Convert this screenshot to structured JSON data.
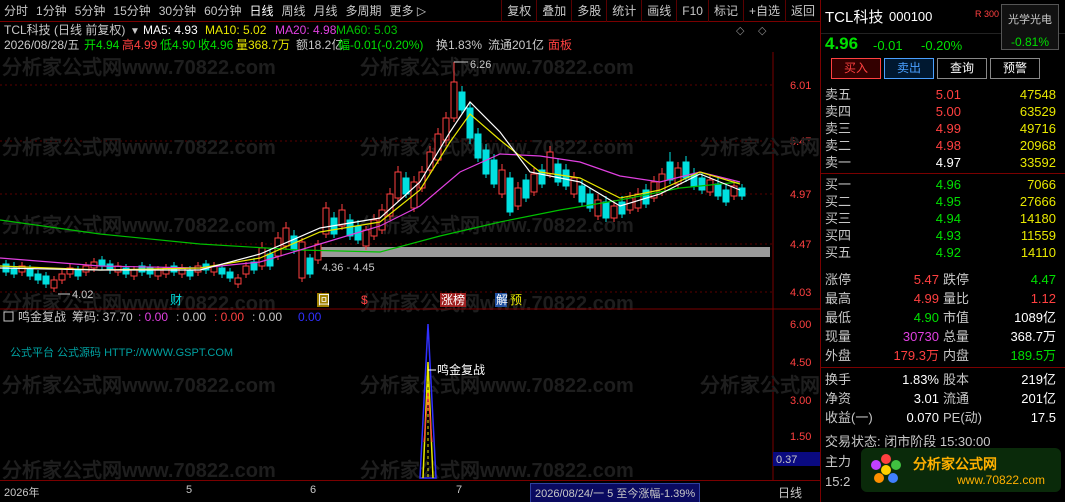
{
  "toolbar": {
    "periods": [
      "分时",
      "1分钟",
      "5分钟",
      "15分钟",
      "30分钟",
      "60分钟",
      "日线",
      "周线",
      "月线",
      "多周期",
      "更多 ▷"
    ],
    "active_period": "日线",
    "tools": [
      "复权",
      "叠加",
      "多股",
      "统计",
      "画线",
      "F10",
      "标记",
      "+自选",
      "返回"
    ]
  },
  "chart": {
    "header_name": "TCL科技 (日线 前复权)",
    "ma5": "MA5: 4.93",
    "ma10": "MA10: 5.02",
    "ma20": "MA20: 4.98",
    "ma60": "MA60: 5.03",
    "bar_date": "2026/08/28/五",
    "bar_open": "开4.94",
    "bar_high": "高4.99",
    "bar_low": "低4.90",
    "bar_close": "收4.96",
    "bar_volume": "量368.7万",
    "bar_amount": "额18.2亿",
    "bar_change": "幅-0.01(-0.20%)",
    "bar_turnover": "换1.83%",
    "bar_float": "流通201亿",
    "bar_board": "面板",
    "price_ticks": [
      "6.01",
      "5.47",
      "4.97",
      "4.47",
      "4.03"
    ],
    "high_label": "6.26",
    "low_label": "4.02",
    "range_label": "4.36 - 4.45",
    "event_tags": [
      "财",
      "回",
      "$",
      "涨榜",
      "解",
      "预"
    ],
    "watermark": "分析家公式网www.70822.com",
    "colors": {
      "up": "#ff4040",
      "down": "#00e0e0",
      "ma5": "#ffffff",
      "ma10": "#e8e800",
      "ma20": "#e040e0",
      "ma60": "#00c000"
    }
  },
  "indicator": {
    "name": "鸣金复战",
    "label": "筹码: 37.70",
    "values": [
      ": 0.00",
      ": 0.00",
      ": 0.00",
      ": 0.00",
      "0.00"
    ],
    "subtitle": "公式平台 公式源码 HTTP://WWW.GSPT.COM",
    "signal_label": "鸣金复战",
    "ticks": [
      "6.00",
      "4.50",
      "3.00",
      "1.50"
    ],
    "current": "0.37"
  },
  "bottom": {
    "x_labels": [
      "2026年",
      "5",
      "6",
      "7"
    ],
    "hint": "2026/08/24/一 5 至今涨幅-1.39%",
    "mode": "日线"
  },
  "quote": {
    "name": "TCL科技",
    "code": "000100",
    "r_tag": "R 300",
    "sector_name": "光学光电",
    "sector_pct": "-0.81%",
    "price": "4.96",
    "change": "-0.01",
    "pct": "-0.20%",
    "buttons": [
      "买入",
      "卖出",
      "查询",
      "预警"
    ],
    "asks": [
      {
        "label": "卖五",
        "price": "5.01",
        "vol": "47548",
        "color": "red"
      },
      {
        "label": "卖四",
        "price": "5.00",
        "vol": "63529",
        "color": "red"
      },
      {
        "label": "卖三",
        "price": "4.99",
        "vol": "49716",
        "color": "red"
      },
      {
        "label": "卖二",
        "price": "4.98",
        "vol": "20968",
        "color": "red"
      },
      {
        "label": "卖一",
        "price": "4.97",
        "vol": "33592",
        "color": "white"
      }
    ],
    "bids": [
      {
        "label": "买一",
        "price": "4.96",
        "vol": "7066",
        "color": "green"
      },
      {
        "label": "买二",
        "price": "4.95",
        "vol": "27666",
        "color": "green"
      },
      {
        "label": "买三",
        "price": "4.94",
        "vol": "14180",
        "color": "green"
      },
      {
        "label": "买四",
        "price": "4.93",
        "vol": "11559",
        "color": "green"
      },
      {
        "label": "买五",
        "price": "4.92",
        "vol": "14110",
        "color": "green"
      }
    ],
    "stats": [
      {
        "l1": "涨停",
        "v1": "5.47",
        "c1": "red",
        "l2": "跌停",
        "v2": "4.47",
        "c2": "green"
      },
      {
        "l1": "最高",
        "v1": "4.99",
        "c1": "red",
        "l2": "量比",
        "v2": "1.12",
        "c2": "red"
      },
      {
        "l1": "最低",
        "v1": "4.90",
        "c1": "green",
        "l2": "市值",
        "v2": "1089亿",
        "c2": "white"
      },
      {
        "l1": "现量",
        "v1": "30730",
        "c1": "purple",
        "l2": "总量",
        "v2": "368.7万",
        "c2": "white"
      },
      {
        "l1": "外盘",
        "v1": "179.3万",
        "c1": "red",
        "l2": "内盘",
        "v2": "189.5万",
        "c2": "green"
      },
      {
        "l1": "换手",
        "v1": "1.83%",
        "c1": "white",
        "l2": "股本",
        "v2": "219亿",
        "c2": "white"
      },
      {
        "l1": "净资",
        "v1": "3.01",
        "c1": "white",
        "l2": "流通",
        "v2": "201亿",
        "c2": "white"
      },
      {
        "l1": "收益(一)",
        "v1": "0.070",
        "c1": "white",
        "l2": "PE(动)",
        "v2": "17.5",
        "c2": "white"
      }
    ],
    "status_label": "交易状态: 闭市阶段 15:30:00",
    "main_label": "主力",
    "time_label": "15:2",
    "logo_title": "分析家公式网",
    "logo_url": "www.70822.com"
  }
}
